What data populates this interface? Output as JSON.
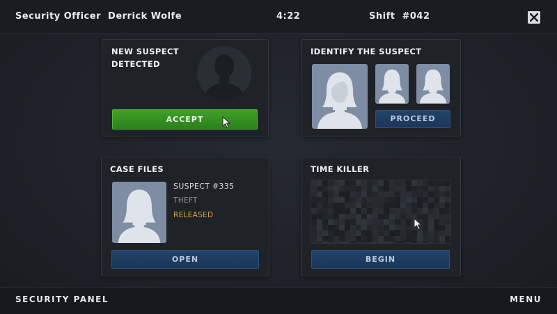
{
  "header": {
    "officer": "Security Officer  Derrick Wolfe",
    "time": "4:22",
    "shift": "Shift  #042"
  },
  "panels": {
    "new_suspect": {
      "title_line1": "NEW SUSPECT",
      "title_line2": "DETECTED",
      "accept_label": "ACCEPT"
    },
    "identify": {
      "title": "IDENTIFY THE SUSPECT",
      "proceed_label": "PROCEED"
    },
    "case_files": {
      "title": "CASE FILES",
      "suspect_id": "SUSPECT #335",
      "crime": "THEFT",
      "status": "RELEASED",
      "status_color": "#d9a63a",
      "open_label": "OPEN"
    },
    "time_killer": {
      "title": "TIME KILLER",
      "begin_label": "BEGIN"
    }
  },
  "footer": {
    "left_label": "SECURITY PANEL",
    "menu_label": "MENU"
  },
  "colors": {
    "accept_green": "#3a9a27",
    "button_blue": "#1f3d61",
    "portrait_bg": "#7e8da3",
    "silhouette": "#dfe3ea"
  }
}
